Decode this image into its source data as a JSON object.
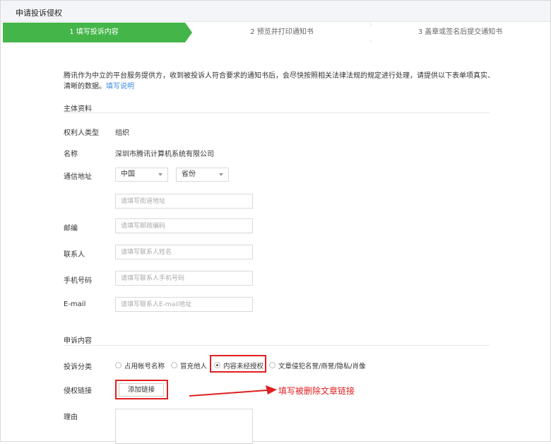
{
  "header": {
    "title": "申请投诉侵权"
  },
  "steps": [
    {
      "label": "1 填写投诉内容",
      "active": true
    },
    {
      "label": "2 预览并打印通知书",
      "active": false
    },
    {
      "label": "3 盖章或签名后提交通知书",
      "active": false
    }
  ],
  "intro": {
    "text": "腾讯作为中立的平台服务提供方，收到被投诉人符合要求的通知书后，会尽快按照相关法律法规的规定进行处理，请提供以下表单项真实、清晰的数据。",
    "link": "填写说明"
  },
  "subject_section": {
    "title": "主体资料",
    "right_holder_type": {
      "label": "权利人类型",
      "value": "组织"
    },
    "name": {
      "label": "名称",
      "value": "深圳市腾讯计算机系统有限公司"
    },
    "address": {
      "label": "通信地址",
      "country": "中国",
      "province": "省份",
      "street_placeholder": "请填写街道地址"
    },
    "postcode": {
      "label": "邮编",
      "placeholder": "请填写邮政编码"
    },
    "contact": {
      "label": "联系人",
      "placeholder": "请填写联系人姓名"
    },
    "phone": {
      "label": "手机号码",
      "placeholder": "请填写联系人手机号码"
    },
    "email": {
      "label": "E-mail",
      "placeholder": "请填写联系人E-mail地址"
    }
  },
  "complaint_section": {
    "title": "申诉内容",
    "category": {
      "label": "投诉分类",
      "options": [
        "占用帐号名称",
        "冒充他人",
        "内容未经授权",
        "文章侵犯名誉/商誉/隐私/肖像"
      ],
      "selected_index": 2
    },
    "link": {
      "label": "侵权链接",
      "button": "添加链接"
    },
    "reason": {
      "label": "理由"
    }
  },
  "annotation": {
    "text": "填写被删除文章链接",
    "color": "#e02020"
  },
  "colors": {
    "accent": "#44b549",
    "link": "#3c8adf",
    "highlight": "#e02020"
  }
}
